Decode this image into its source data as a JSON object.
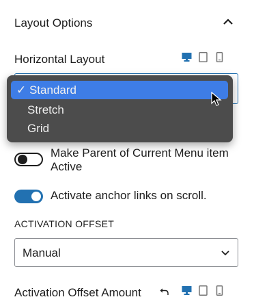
{
  "panel": {
    "title": "Layout Options",
    "collapse_icon": "chevron-up-icon"
  },
  "horizontal_layout": {
    "label": "Horizontal Layout",
    "device_icons": [
      "desktop-icon",
      "tablet-icon",
      "mobile-icon"
    ],
    "active_device": "desktop",
    "dropdown": {
      "options": [
        {
          "label": "Standard",
          "selected": true
        },
        {
          "label": "Stretch",
          "selected": false
        },
        {
          "label": "Grid",
          "selected": false
        }
      ],
      "checkmark": "✓",
      "highlight_color": "#3e7de6"
    }
  },
  "toggles": [
    {
      "label": "Make Parent of Current Menu item Active",
      "on": false
    },
    {
      "label": "Activate anchor links on scroll.",
      "on": true
    }
  ],
  "activation_offset": {
    "label": "ACTIVATION OFFSET",
    "value": "Manual"
  },
  "offset_amount": {
    "label": "Activation Offset Amount",
    "reset_icon": "undo-icon",
    "device_icons": [
      "desktop-icon",
      "tablet-icon",
      "mobile-icon"
    ],
    "active_device": "desktop"
  },
  "colors": {
    "accent": "#2271b1",
    "text": "#1e1e1e",
    "menu_bg": "#4c4c4c"
  }
}
